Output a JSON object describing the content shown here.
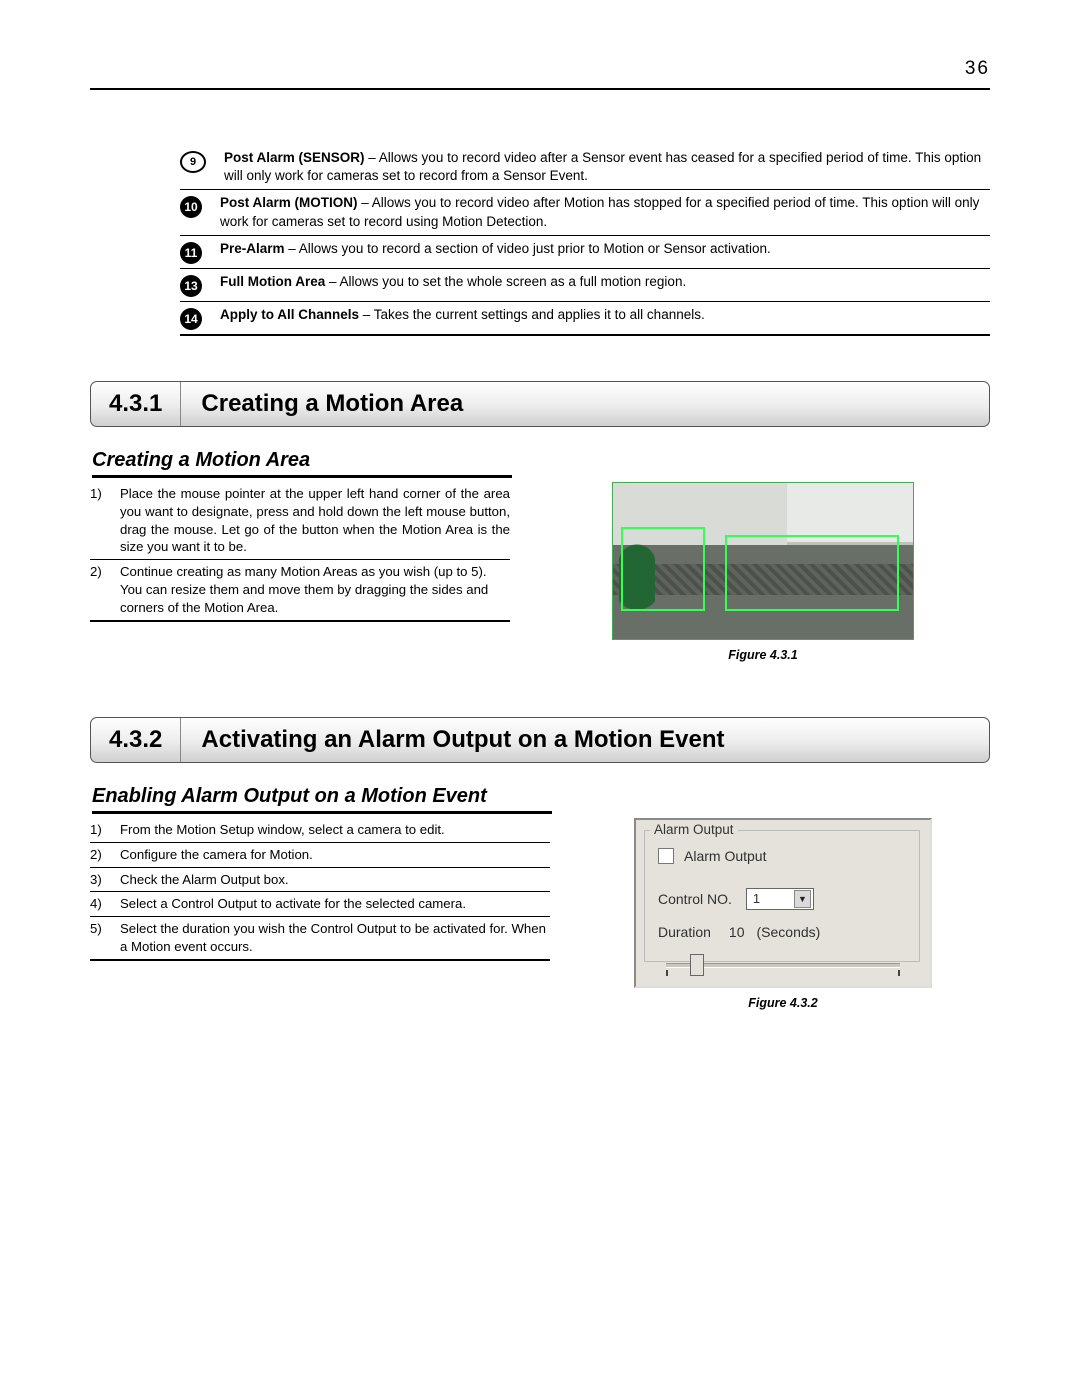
{
  "page_number": "36",
  "definitions": [
    {
      "num": "9",
      "style": "outline",
      "bold": "Post Alarm (SENSOR)",
      "rest": " – Allows you to record video after a Sensor event has ceased for a specified period of time. This option will only work for cameras set to record from a Sensor Event."
    },
    {
      "num": "10",
      "style": "solid",
      "bold": "Post Alarm (MOTION)",
      "rest": " – Allows you to record video after Motion has stopped for a specified period of time. This option will only work for cameras set to record using Motion Detection."
    },
    {
      "num": "11",
      "style": "solid",
      "bold": "Pre-Alarm",
      "rest": " – Allows you to record a section of video just prior to Motion or Sensor activation."
    },
    {
      "num": "13",
      "style": "solid",
      "bold": "Full Motion Area",
      "rest": " – Allows you to set the whole screen as a full motion region."
    },
    {
      "num": "14",
      "style": "solid",
      "bold": "Apply to All Channels",
      "rest": " – Takes the current settings and applies it to all channels."
    }
  ],
  "section1": {
    "num": "4.3.1",
    "title": "Creating a Motion Area",
    "subtitle": "Creating a Motion Area",
    "steps": [
      {
        "n": "1)",
        "t": "Place the mouse pointer at the upper left hand corner of the area you want to designate, press and hold down the left mouse button, drag the mouse. Let go of the button when the Motion Area is the size you want it to be."
      },
      {
        "n": "2)",
        "t": "Continue creating as many Motion Areas as you wish (up to 5). You can resize them and move them by dragging the sides and corners of the Motion Area."
      }
    ],
    "figure_caption": "Figure 4.3.1"
  },
  "section2": {
    "num": "4.3.2",
    "title": "Activating an Alarm Output on a Motion Event",
    "subtitle": "Enabling Alarm Output on a Motion Event",
    "steps": [
      {
        "n": "1)",
        "t": "From the Motion Setup window, select a camera to edit."
      },
      {
        "n": "2)",
        "t": "Configure the camera for Motion."
      },
      {
        "n": "3)",
        "t": "Check the Alarm Output box."
      },
      {
        "n": "4)",
        "t": "Select a Control Output to activate for the selected camera."
      },
      {
        "n": "5)",
        "t": "Select the duration you wish the Control Output to be activated for. When a Motion event occurs."
      }
    ],
    "figure_caption": "Figure 4.3.2"
  },
  "alarm_panel": {
    "legend": "Alarm Output",
    "checkbox_label": "Alarm Output",
    "control_label": "Control NO.",
    "control_value": "1",
    "duration_label": "Duration",
    "duration_value": "10",
    "duration_unit": "(Seconds)"
  }
}
